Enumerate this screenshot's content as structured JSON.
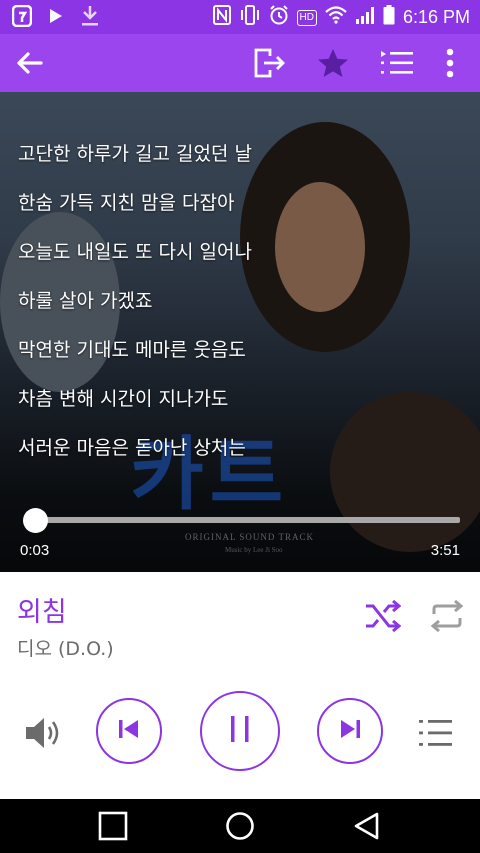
{
  "status_bar": {
    "time": "6:16 PM",
    "icons": [
      "app-notification-icon",
      "play-notification-icon",
      "download-icon",
      "nfc-icon",
      "vibrate-icon",
      "alarm-icon",
      "hd-voice-icon",
      "wifi-icon",
      "signal-icon",
      "battery-icon"
    ],
    "hd_label": "HD"
  },
  "app_bar": {
    "icons": [
      "back-arrow-icon",
      "exit-icon",
      "star-icon",
      "playlist-icon",
      "more-vert-icon"
    ]
  },
  "lyrics": [
    "고단한 하루가 길고 길었던 날",
    "한숨 가득 지친 맘을 다잡아",
    "오늘도 내일도 또 다시 일어나",
    "하룰 살아 가겠죠",
    "막연한 기대도 메마른 웃음도",
    "차츰 변해 시간이 지나가도",
    "서러운 마음은 돋아난 상처는"
  ],
  "poster": {
    "title": "카트",
    "subtitle": "ORIGINAL SOUND TRACK",
    "credit": "Music by Lee Ji Soo"
  },
  "player": {
    "elapsed": "0:03",
    "duration": "3:51",
    "progress_fraction": 0.013
  },
  "song": {
    "title": "외침",
    "artist": "디오 (D.O.)"
  },
  "controls": {
    "icons": [
      "shuffle-icon",
      "repeat-icon",
      "volume-icon",
      "previous-icon",
      "pause-icon",
      "next-icon",
      "queue-list-icon"
    ]
  },
  "nav_bar": {
    "icons": [
      "recents-square-icon",
      "home-circle-icon",
      "back-triangle-icon"
    ]
  },
  "colors": {
    "accent": "#8b35e5",
    "appbar": "#9a45ee",
    "artist_gray": "#6b6b6b",
    "icon_gray": "#9e9e9e"
  }
}
